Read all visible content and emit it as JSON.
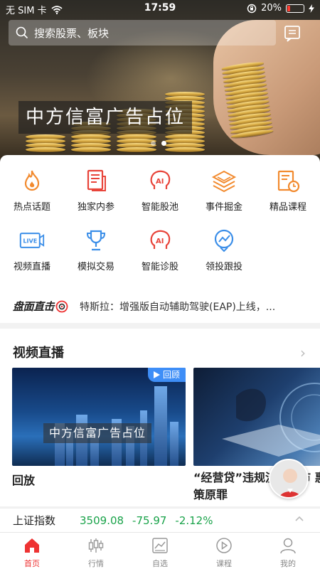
{
  "status_bar": {
    "carrier": "无 SIM 卡",
    "time": "17:59",
    "battery": "20%",
    "battery_level": 0.2
  },
  "search": {
    "placeholder": "搜索股票、板块"
  },
  "banner": {
    "text": "中方信富广告占位",
    "slide_count": 2,
    "active_slide": 2
  },
  "menu": {
    "row1": [
      {
        "label": "热点话题",
        "icon": "flame-icon"
      },
      {
        "label": "独家内参",
        "icon": "document-icon"
      },
      {
        "label": "智能股池",
        "icon": "ai-head-icon"
      },
      {
        "label": "事件掘金",
        "icon": "layers-icon"
      },
      {
        "label": "精品课程",
        "icon": "course-clock-icon"
      }
    ],
    "row2": [
      {
        "label": "视频直播",
        "icon": "live-camera-icon"
      },
      {
        "label": "模拟交易",
        "icon": "trophy-icon"
      },
      {
        "label": "智能诊股",
        "icon": "ai-head-icon"
      },
      {
        "label": "领投跟投",
        "icon": "trend-bubble-icon"
      }
    ]
  },
  "ticker": {
    "brand": "盘面直击",
    "text": "特斯拉：增强版自动辅助驾驶(EAP)上线，..."
  },
  "video_section": {
    "title": "视频直播",
    "videos": [
      {
        "title": "回放",
        "badge": "回顾",
        "overlay": "中方信富广告占位"
      },
      {
        "title": "“经营贷”违规流入楼市 惠策原罪"
      }
    ]
  },
  "index_bar": {
    "name": "上证指数",
    "price": "3509.08",
    "change": "-75.97",
    "percent": "-2.12%",
    "color": "#1aa34a"
  },
  "tabs": [
    {
      "label": "首页",
      "icon": "home-icon",
      "active": true
    },
    {
      "label": "行情",
      "icon": "candlestick-icon"
    },
    {
      "label": "自选",
      "icon": "chart-card-icon"
    },
    {
      "label": "课程",
      "icon": "play-circle-icon"
    },
    {
      "label": "我的",
      "icon": "person-icon"
    }
  ],
  "colors": {
    "accent": "#e33333",
    "menu_red": "#e8443a",
    "menu_orange": "#f28a2e",
    "menu_blue": "#3b8ee8",
    "up_down_green": "#1aa34a"
  }
}
